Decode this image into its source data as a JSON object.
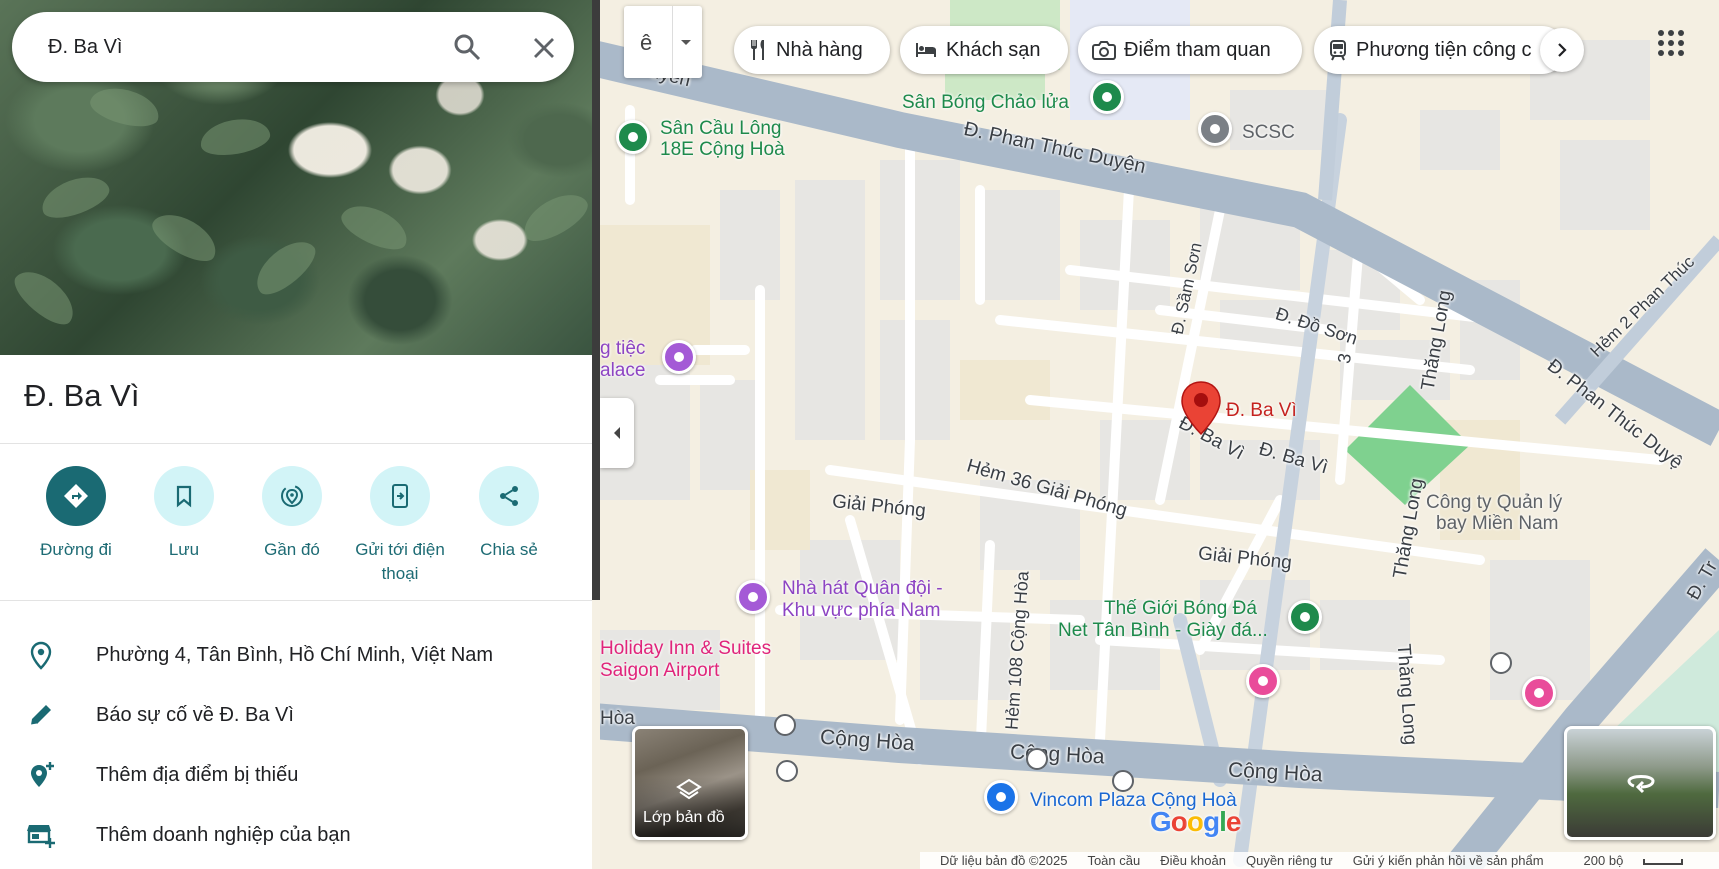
{
  "search": {
    "value": "Đ. Ba Vì"
  },
  "place": {
    "title": "Đ. Ba Vì"
  },
  "actions": [
    {
      "label": "Đường đi",
      "icon": "directions-icon"
    },
    {
      "label": "Lưu",
      "icon": "bookmark-icon"
    },
    {
      "label": "Gần đó",
      "icon": "nearby-icon"
    },
    {
      "label": "Gửi tới điện thoại",
      "icon": "send-to-phone-icon"
    },
    {
      "label": "Chia sẻ",
      "icon": "share-icon"
    }
  ],
  "info": {
    "address": "Phường 4, Tân Bình, Hồ Chí Minh, Việt Nam",
    "report": "Báo sự cố về Đ. Ba Vì",
    "add_place": "Thêm địa điểm bị thiếu",
    "add_business": "Thêm doanh nghiệp của bạn"
  },
  "lang_button": {
    "glyph": "ê"
  },
  "chips": [
    {
      "label": "Nhà hàng",
      "icon": "restaurant-icon"
    },
    {
      "label": "Khách sạn",
      "icon": "hotel-icon"
    },
    {
      "label": "Điểm tham quan",
      "icon": "camera-icon"
    },
    {
      "label": "Phương tiện công c",
      "icon": "transit-icon"
    }
  ],
  "map_labels": {
    "duyen_top": "Duyên",
    "phan_thuc_duyen": "Đ. Phan Thúc Duyện",
    "phan_thuc_duyen_right": "Đ. Phan Thúc Duyệ",
    "hem2_phan_thuc": "Hẻm 2 Phan Thúc",
    "sam_son": "Đ. Sầm Sơn",
    "do_son": "Đ. Đồ Sơn",
    "thang_long_1": "Thăng Long",
    "thang_long_2": "Thăng Long",
    "thang_long_3": "Thăng Long",
    "ba_vi_1": "Đ. Ba Vì",
    "ba_vi_2": "Đ. Ba Vì",
    "hem36": "Hẻm 36 Giải Phóng",
    "giai_phong_1": "Giải Phóng",
    "giai_phong_2": "Giải Phóng",
    "hem108": "Hẻm 108 Cộng Hòa",
    "cong_hoa_1": "Cộng Hòa",
    "cong_hoa_2": "Cộng Hòa",
    "cong_hoa_3": "Cộng Hòa",
    "hoa_left": "Hòa",
    "three": "3",
    "t_right": "Đ. Tr"
  },
  "pois": {
    "san_bong": "Sân Bóng Chảo lửa",
    "san_cau_long_1": "Sân Cầu Lông",
    "san_cau_long_2": "18E Cộng Hoà",
    "scsc": "SCSC",
    "tiec_1": "g tiệc",
    "tiec_2": "alace",
    "selected": "Đ. Ba Vì",
    "cong_ty_1": "Công ty Quản lý",
    "cong_ty_2": "bay Miền Nam",
    "nha_hat_1": "Nhà hát Quân đội -",
    "nha_hat_2": "Khu vực phía Nam",
    "holiday_1": "Holiday Inn & Suites",
    "holiday_2": "Saigon Airport",
    "the_gioi_1": "Thế Giới Bóng Đá",
    "the_gioi_2": "Net Tân Bình - Giày đá...",
    "vincom": "Vincom Plaza Cộng Hoà"
  },
  "layers": {
    "label": "Lớp bản đồ"
  },
  "footer": {
    "data": "Dữ liệu bản đồ ©2025",
    "global": "Toàn cầu",
    "terms": "Điều khoản",
    "privacy": "Quyền riêng tư",
    "feedback": "Gửi ý kiến phản hồi về sản phẩm",
    "scale": "200 bộ"
  },
  "colors": {
    "accent": "#1a6a73",
    "accent_light": "#d2f4f7",
    "road_major": "#aab9c9",
    "pin_red": "#ea4335"
  }
}
